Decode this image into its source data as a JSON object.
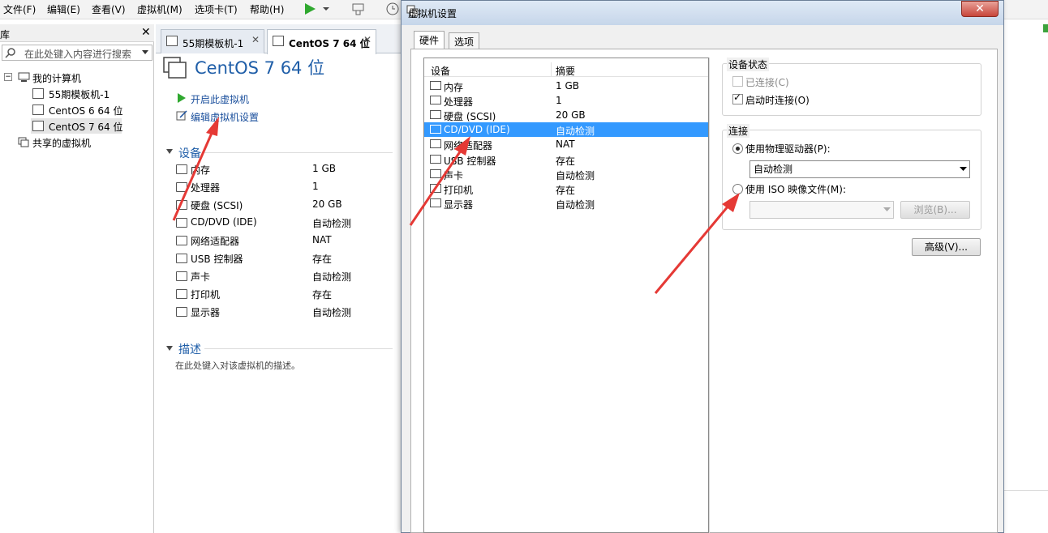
{
  "menubar": {
    "items": [
      "文件(F)",
      "编辑(E)",
      "查看(V)",
      "虚拟机(M)",
      "选项卡(T)",
      "帮助(H)"
    ]
  },
  "library": {
    "header": "库",
    "search_placeholder": "在此处键入内容进行搜索",
    "tree": {
      "root": "我的计算机",
      "children": [
        "55期模板机-1",
        "CentOS 6 64 位",
        "CentOS 7 64 位"
      ],
      "shared": "共享的虚拟机"
    }
  },
  "doc_tabs": [
    {
      "label": "55期模板机-1"
    },
    {
      "label": "CentOS 7 64 位"
    }
  ],
  "vm": {
    "title": "CentOS 7 64 位",
    "actions": [
      "开启此虚拟机",
      "编辑虚拟机设置"
    ],
    "devices_section": "设备",
    "devices": [
      {
        "name": "内存",
        "value": "1 GB",
        "icon": "memory-icon"
      },
      {
        "name": "处理器",
        "value": "1",
        "icon": "cpu-icon"
      },
      {
        "name": "硬盘 (SCSI)",
        "value": "20 GB",
        "icon": "disk-icon"
      },
      {
        "name": "CD/DVD (IDE)",
        "value": "自动检测",
        "icon": "cd-icon"
      },
      {
        "name": "网络适配器",
        "value": "NAT",
        "icon": "network-icon"
      },
      {
        "name": "USB 控制器",
        "value": "存在",
        "icon": "usb-icon"
      },
      {
        "name": "声卡",
        "value": "自动检测",
        "icon": "sound-icon"
      },
      {
        "name": "打印机",
        "value": "存在",
        "icon": "printer-icon"
      },
      {
        "name": "显示器",
        "value": "自动检测",
        "icon": "display-icon"
      }
    ],
    "description_section": "描述",
    "description_placeholder": "在此处键入对该虚拟机的描述。"
  },
  "dialog": {
    "title": "虚拟机设置",
    "close": "✕",
    "tabs": [
      "硬件",
      "选项"
    ],
    "list_headers": [
      "设备",
      "摘要"
    ],
    "devices": [
      {
        "name": "内存",
        "value": "1 GB"
      },
      {
        "name": "处理器",
        "value": "1"
      },
      {
        "name": "硬盘 (SCSI)",
        "value": "20 GB"
      },
      {
        "name": "CD/DVD (IDE)",
        "value": "自动检测"
      },
      {
        "name": "网络适配器",
        "value": "NAT"
      },
      {
        "name": "USB 控制器",
        "value": "存在"
      },
      {
        "name": "声卡",
        "value": "自动检测"
      },
      {
        "name": "打印机",
        "value": "存在"
      },
      {
        "name": "显示器",
        "value": "自动检测"
      }
    ],
    "selected_index": 3,
    "device_status": {
      "title": "设备状态",
      "connected": "已连接(C)",
      "connected_checked": false,
      "connect_on_power": "启动时连接(O)",
      "connect_on_power_checked": true
    },
    "connection": {
      "title": "连接",
      "physical": "使用物理驱动器(P):",
      "physical_selected": true,
      "physical_value": "自动检测",
      "iso": "使用 ISO 映像文件(M):",
      "iso_selected": false,
      "browse": "浏览(B)..."
    },
    "advanced": "高级(V)..."
  },
  "colors": {
    "selection": "#3399ff",
    "title_blue": "#1f5ea8",
    "annotation_arrow": "#e53935"
  }
}
